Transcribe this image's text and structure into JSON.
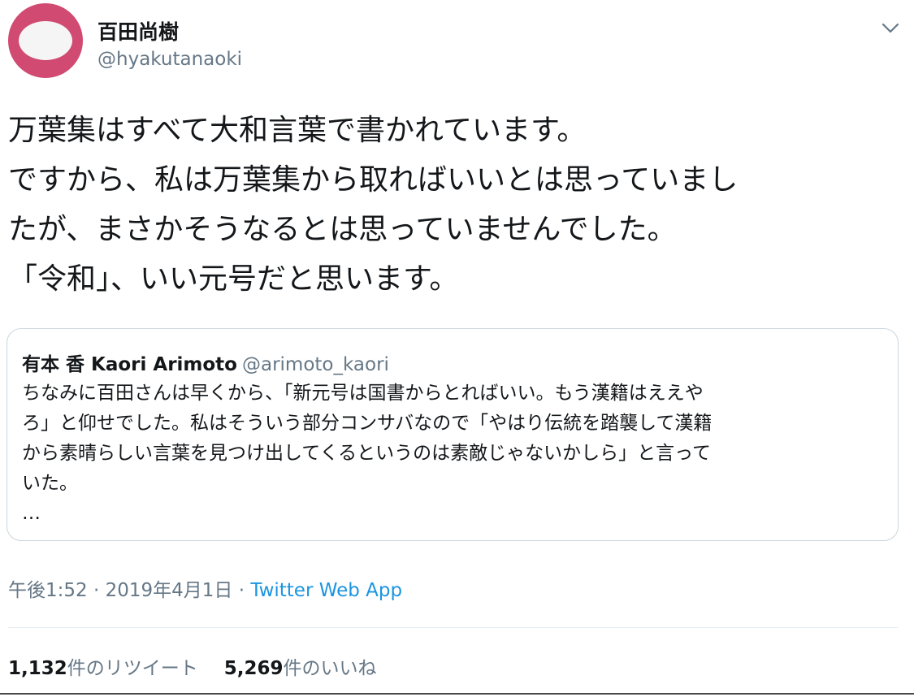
{
  "author": {
    "display_name": "百田尚樹",
    "handle": "@hyakutanaoki",
    "avatar_colors": {
      "outer": "#d14a72",
      "inner": "#f5f5f5"
    }
  },
  "menu_icon": "chevron-down-icon",
  "tweet": {
    "lines": [
      "万葉集はすべて大和言葉で書かれています。",
      "ですから、私は万葉集から取ればいいとは思っていまし",
      "たが、まさかそうなるとは思っていませんでした。",
      "「令和」、いい元号だと思います。"
    ]
  },
  "quoted_tweet": {
    "author_name": "有本 香 Kaori Arimoto",
    "author_handle": "@arimoto_kaori",
    "lines": [
      "ちなみに百田さんは早くから、「新元号は国書からとればいい。もう漢籍はええや",
      "ろ」と仰せでした。私はそういう部分コンサバなので「やはり伝統を踏襲して漢籍",
      "から素晴らしい言葉を見つけ出してくるというのは素敵じゃないかしら」と言って",
      "いた。",
      "…"
    ]
  },
  "meta": {
    "timestamp": "午後1:52 · 2019年4月1日",
    "separator": " · ",
    "source": "Twitter Web App"
  },
  "stats": {
    "retweets_count": "1,132",
    "retweets_label": "件のリツイート",
    "likes_count": "5,269",
    "likes_label": "件のいいね"
  },
  "colors": {
    "text": "#14171a",
    "secondary": "#657786",
    "link": "#1b95e0",
    "border": "#ccd6dd"
  }
}
